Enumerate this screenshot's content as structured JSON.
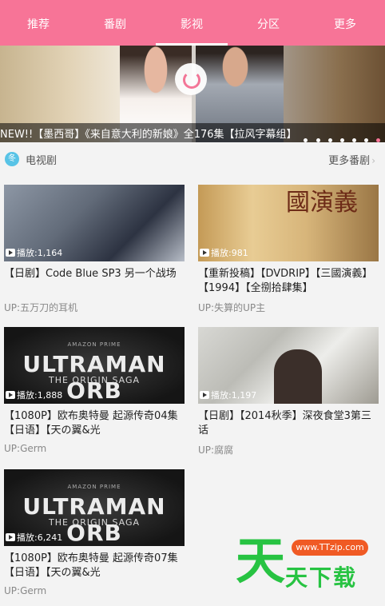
{
  "tabs": [
    "推荐",
    "番剧",
    "影视",
    "分区",
    "更多"
  ],
  "active_tab_index": 2,
  "banner": {
    "caption": "NEW!!【墨西哥】《来自意大利的新娘》全176集【拉风字幕组】",
    "dot_count": 7,
    "active_dot": 6
  },
  "section": {
    "icon": "tv-icon",
    "icon_glyph": "冬",
    "title": "电视剧",
    "more": "更多番剧"
  },
  "cards": [
    {
      "plays": "播放:1,164",
      "title": "【日剧】Code Blue SP3 另一个战场",
      "up": "UP:五万刀的耳机",
      "thumb": "gray1"
    },
    {
      "plays": "播放:981",
      "title": "【重新投稿】【DVDRIP】【三國演義】【1994】【全捌拾肆集】",
      "up": "UP:失算的UP主",
      "thumb": "book",
      "thumb_text": "國演義"
    },
    {
      "plays": "播放:1,888",
      "title": "【1080P】欧布奥特曼 起源传奇04集【日语】【天の翼&光",
      "up": "UP:Germ",
      "thumb": "ultraman",
      "thumb_top": "AMAZON PRIME",
      "thumb_title": "ULTRAMAN ORB",
      "thumb_sub": "THE ORIGIN SAGA"
    },
    {
      "plays": "播放:1,197",
      "title": "【日剧】【2014秋季】深夜食堂3第三话",
      "up": "UP:腐腐",
      "thumb": "office"
    },
    {
      "plays": "播放:6,241",
      "title": "【1080P】欧布奥特曼 起源传奇07集【日语】【天の翼&光",
      "up": "UP:Germ",
      "thumb": "ultraman",
      "thumb_top": "AMAZON PRIME",
      "thumb_title": "ULTRAMAN ORB",
      "thumb_sub": "THE ORIGIN SAGA"
    }
  ],
  "watermark": {
    "logo": "天",
    "url": "www.TTzip.com",
    "name": "天下载"
  },
  "colors": {
    "accent": "#f77497",
    "section_icon": "#58c3e6",
    "watermark_green": "#27c342",
    "watermark_orange": "#f05a24"
  }
}
